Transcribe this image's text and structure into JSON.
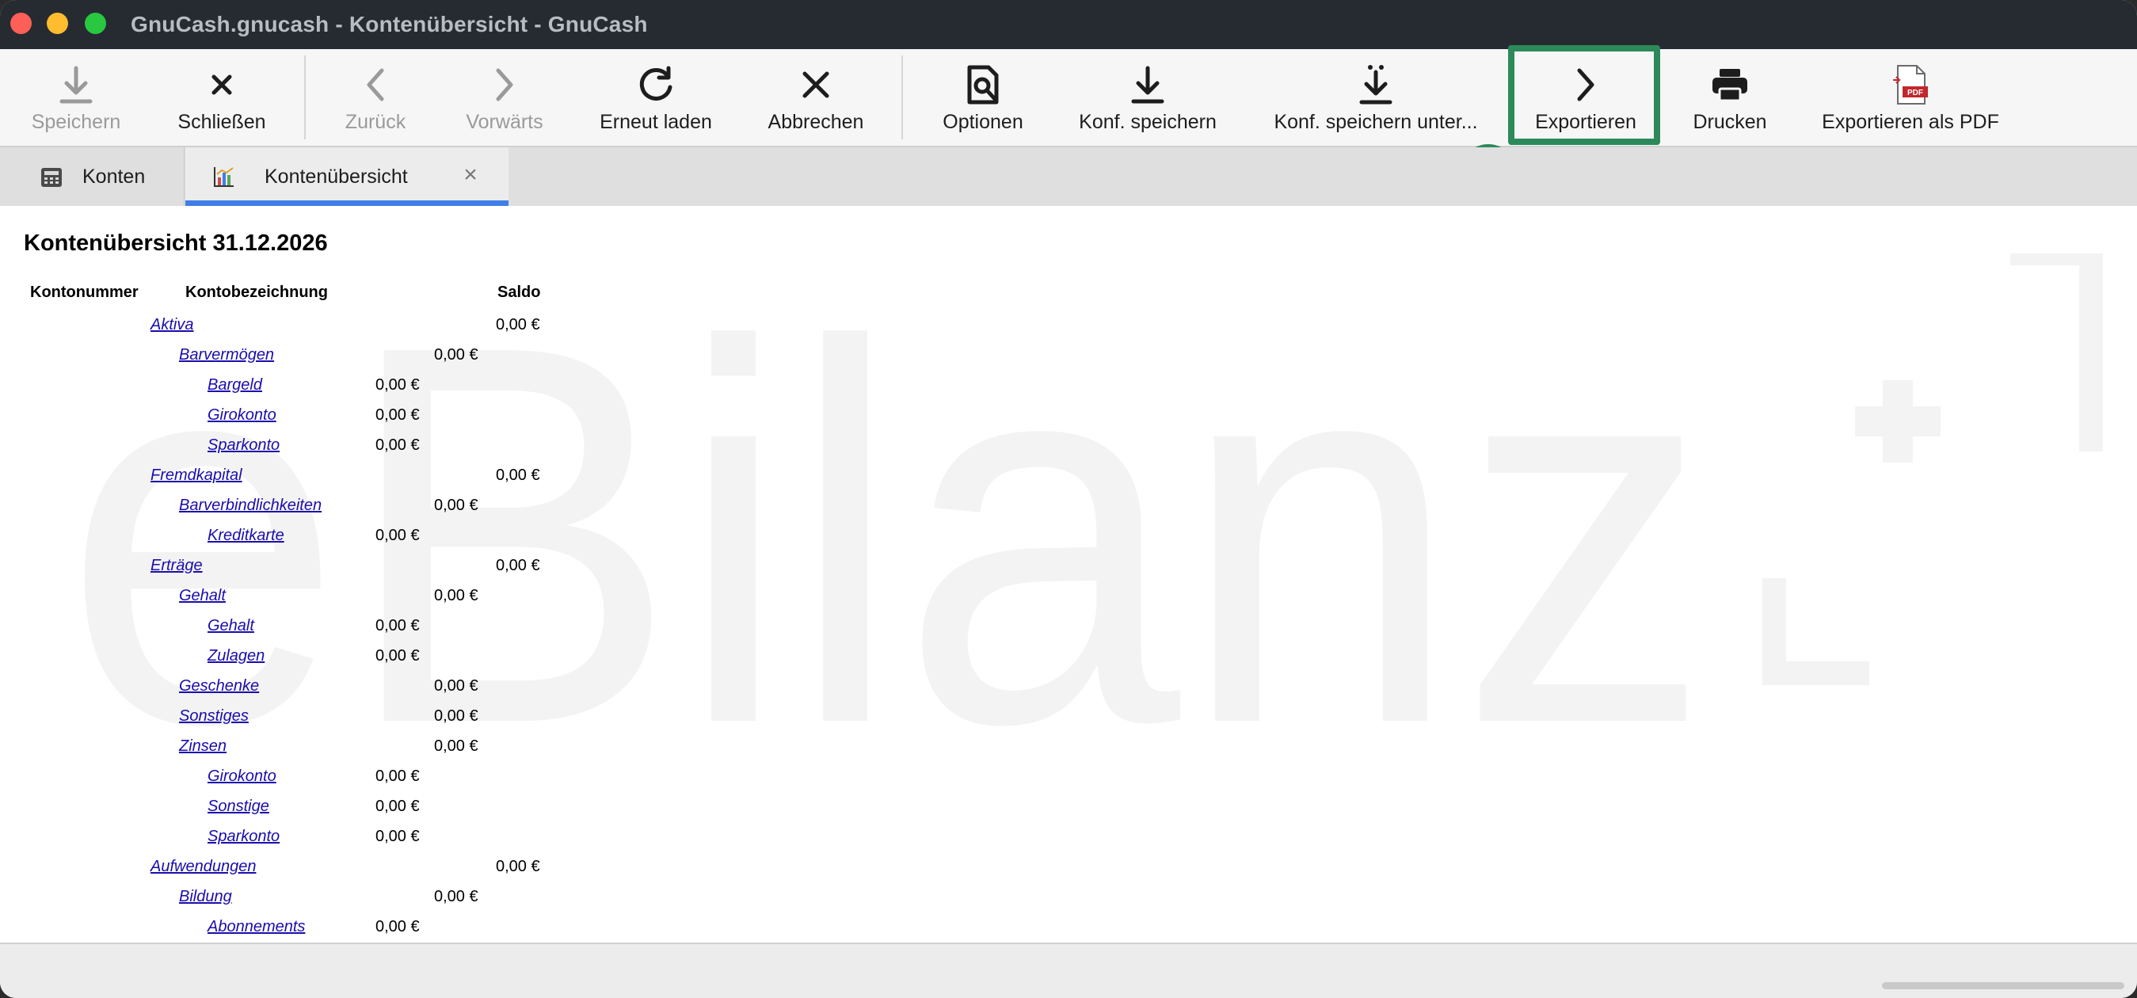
{
  "window": {
    "title": "GnuCash.gnucash - Kontenübersicht - GnuCash"
  },
  "toolbar": {
    "save": "Speichern",
    "close": "Schließen",
    "back": "Zurück",
    "forward": "Vorwärts",
    "reload": "Erneut laden",
    "cancel": "Abbrechen",
    "options": "Optionen",
    "save_config": "Konf. speichern",
    "save_config_as": "Konf. speichern unter...",
    "export": "Exportieren",
    "print": "Drucken",
    "export_pdf": "Exportieren als PDF"
  },
  "annotation": {
    "step": "5",
    "color": "#2c8a5a"
  },
  "tabs": [
    {
      "label": "Konten",
      "icon": "accounts-icon",
      "active": false
    },
    {
      "label": "Kontenübersicht",
      "icon": "report-chart-icon",
      "active": true,
      "close": "×"
    }
  ],
  "report": {
    "title": "Kontenübersicht 31.12.2026",
    "columns": [
      "Kontonummer",
      "Kontobezeichnung",
      "Saldo"
    ],
    "rows": [
      {
        "name": "Aktiva",
        "level": 0,
        "amount": "0,00 €"
      },
      {
        "name": "Barvermögen",
        "level": 1,
        "amount": "0,00 €"
      },
      {
        "name": "Bargeld",
        "level": 2,
        "amount": "0,00 €"
      },
      {
        "name": "Girokonto",
        "level": 2,
        "amount": "0,00 €"
      },
      {
        "name": "Sparkonto",
        "level": 2,
        "amount": "0,00 €"
      },
      {
        "name": "Fremdkapital",
        "level": 0,
        "amount": "0,00 €"
      },
      {
        "name": "Barverbindlichkeiten",
        "level": 1,
        "amount": "0,00 €"
      },
      {
        "name": "Kreditkarte",
        "level": 2,
        "amount": "0,00 €"
      },
      {
        "name": "Erträge",
        "level": 0,
        "amount": "0,00 €"
      },
      {
        "name": "Gehalt",
        "level": 1,
        "amount": "0,00 €"
      },
      {
        "name": "Gehalt",
        "level": 2,
        "amount": "0,00 €"
      },
      {
        "name": "Zulagen",
        "level": 2,
        "amount": "0,00 €"
      },
      {
        "name": "Geschenke",
        "level": 1,
        "amount": "0,00 €"
      },
      {
        "name": "Sonstiges",
        "level": 1,
        "amount": "0,00 €"
      },
      {
        "name": "Zinsen",
        "level": 1,
        "amount": "0,00 €"
      },
      {
        "name": "Girokonto",
        "level": 2,
        "amount": "0,00 €"
      },
      {
        "name": "Sonstige",
        "level": 2,
        "amount": "0,00 €"
      },
      {
        "name": "Sparkonto",
        "level": 2,
        "amount": "0,00 €"
      },
      {
        "name": "Aufwendungen",
        "level": 0,
        "amount": "0,00 €"
      },
      {
        "name": "Bildung",
        "level": 1,
        "amount": "0,00 €"
      },
      {
        "name": "Abonnements",
        "level": 2,
        "amount": "0,00 €"
      }
    ]
  },
  "watermark": {
    "text": "eBilanz"
  }
}
